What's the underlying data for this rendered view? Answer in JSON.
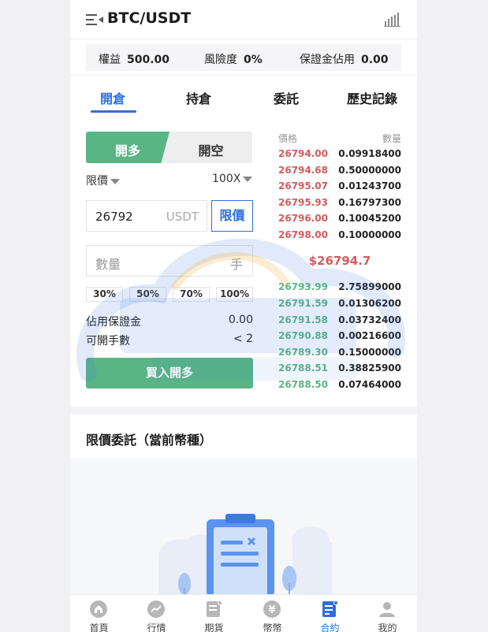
{
  "header": {
    "pair": "BTC/USDT",
    "menu_icon": "menu-icon",
    "chart_icon": "bar-chart-icon"
  },
  "stats": [
    {
      "label": "權益",
      "value": "500.00"
    },
    {
      "label": "風險度",
      "value": "0%"
    },
    {
      "label": "保證金佔用",
      "value": "0.00"
    }
  ],
  "tabs": [
    "開倉",
    "持倉",
    "委託",
    "歷史記錄"
  ],
  "active_tab": 0,
  "order_form": {
    "long_label": "開多",
    "short_label": "開空",
    "order_type": "限價",
    "leverage": "100X",
    "price_value": "26792",
    "price_unit": "USDT",
    "limit_button": "限價",
    "qty_placeholder": "數量",
    "qty_unit": "手",
    "percents": [
      "30%",
      "50%",
      "70%",
      "100%"
    ],
    "margin_label": "佔用保證金",
    "margin_value": "0.00",
    "openable_label": "可開手數",
    "openable_value": "< 2",
    "buy_button": "買入開多"
  },
  "order_book": {
    "price_header": "價格",
    "amount_header": "數量",
    "asks": [
      {
        "price": "26794.00",
        "amount": "0.09918400"
      },
      {
        "price": "26794.68",
        "amount": "0.50000000"
      },
      {
        "price": "26795.07",
        "amount": "0.01243700"
      },
      {
        "price": "26795.93",
        "amount": "0.16797300"
      },
      {
        "price": "26796.00",
        "amount": "0.10045200"
      },
      {
        "price": "26798.00",
        "amount": "0.10000000"
      }
    ],
    "last_price": "$26794.7",
    "bids": [
      {
        "price": "26793.99",
        "amount": "2.75899000"
      },
      {
        "price": "26791.59",
        "amount": "0.01306200"
      },
      {
        "price": "26791.58",
        "amount": "0.03732400"
      },
      {
        "price": "26790.88",
        "amount": "0.00216600"
      },
      {
        "price": "26789.30",
        "amount": "0.15000000"
      },
      {
        "price": "26788.51",
        "amount": "0.38825900"
      },
      {
        "price": "26788.50",
        "amount": "0.07464000"
      }
    ]
  },
  "limit_orders_title": "限價委託（當前幣種）",
  "bottom_nav": [
    {
      "label": "首頁",
      "icon": "home-icon"
    },
    {
      "label": "行情",
      "icon": "market-icon"
    },
    {
      "label": "期貨",
      "icon": "futures-icon"
    },
    {
      "label": "幣幣",
      "icon": "coin-icon"
    },
    {
      "label": "合約",
      "icon": "contract-icon"
    },
    {
      "label": "我的",
      "icon": "user-icon"
    }
  ],
  "active_nav": 4,
  "colors": {
    "accent": "#2e6fdc",
    "buy": "#5ab585",
    "sell": "#d75a5d"
  }
}
